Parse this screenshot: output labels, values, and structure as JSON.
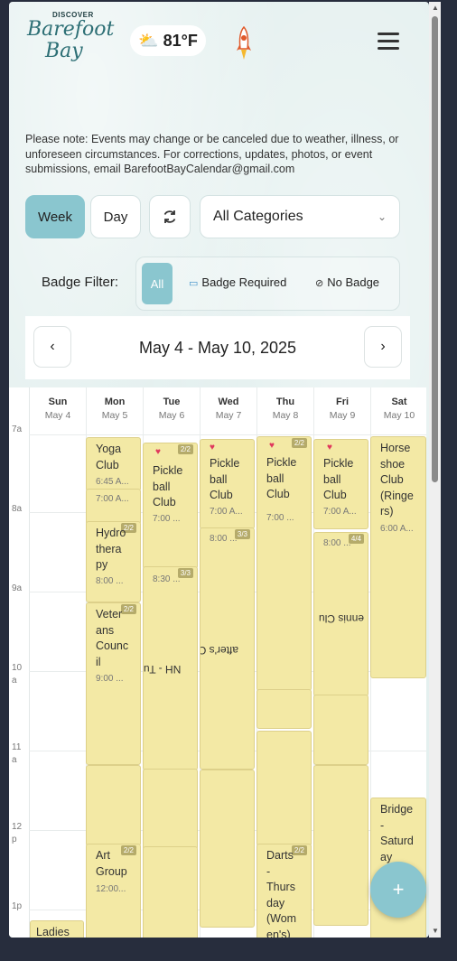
{
  "header": {
    "logo": {
      "small": "DISCOVER",
      "line1": "Barefoot",
      "line2": "Bay"
    },
    "weather": {
      "temp": "81°F",
      "icon": "partly-cloudy-icon"
    },
    "rocket_icon": "rocket-icon",
    "menu_icon": "hamburger-menu-icon"
  },
  "notice": "Please note: Events may change or be canceled due to weather, illness, or unforeseen circumstances. For corrections, updates, photos, or event submissions, email BarefootBayCalendar@gmail.com",
  "controls": {
    "week": "Week",
    "day": "Day",
    "refresh_icon": "refresh-icon",
    "category": "All Categories"
  },
  "badge_filter": {
    "label": "Badge Filter:",
    "all": "All",
    "required": "Badge Required",
    "none": "No Badge"
  },
  "week_nav": {
    "prev": "‹",
    "next": "›",
    "title": "May 4 - May 10, 2025"
  },
  "calendar": {
    "days": [
      {
        "name": "Sun",
        "date": "May 4"
      },
      {
        "name": "Mon",
        "date": "May 5"
      },
      {
        "name": "Tue",
        "date": "May 6"
      },
      {
        "name": "Wed",
        "date": "May 7"
      },
      {
        "name": "Thu",
        "date": "May 8"
      },
      {
        "name": "Fri",
        "date": "May 9"
      },
      {
        "name": "Sat",
        "date": "May 10"
      }
    ],
    "hours": [
      "7a",
      "8a",
      "9a",
      "10\na",
      "11\na",
      "12\np",
      "1p"
    ],
    "events": {
      "mon_yoga": {
        "title": "Yoga\nClub",
        "time": "6:45 A..."
      },
      "mon_club": {
        "title": "Club",
        "time": "7:00 A..."
      },
      "mon_hydro": {
        "title": "Hydro\nthera\npy",
        "time": "8:00 ...",
        "badge": "2/2"
      },
      "mon_vet": {
        "title": "Veter\nans\nCounc\nil",
        "time": "9:00 ...",
        "badge": "2/2"
      },
      "mon_art": {
        "title": "Art\nGroup",
        "time": "12:00...",
        "badge": "2/2"
      },
      "tue_pickle": {
        "title": "Pickle\nball\nClub",
        "time": "7:00 ...",
        "badge": "2/2"
      },
      "tue_830": {
        "time": "8:30 ...",
        "badge": "3/3"
      },
      "tue_rot": {
        "title": "NH - Tu"
      },
      "wed_pickle": {
        "title": "Pickle\nball\nClub",
        "time": "7:00 A..."
      },
      "wed_800": {
        "time": "8:00 ...",
        "badge": "3/3"
      },
      "wed_rot": {
        "title": "after's Cl"
      },
      "thu_pickle": {
        "title": "Pickle\nball\nClub",
        "time": "7:00 ...",
        "badge": "2/2"
      },
      "thu_darts": {
        "title": "Darts\n-\nThurs\nday\n(Wom\nen's)",
        "badge": "2/2"
      },
      "fri_pickle": {
        "title": "Pickle\nball\nClub",
        "time": "7:00 A..."
      },
      "fri_800": {
        "time": "8:00 ...",
        "badge": "4/4"
      },
      "fri_rot": {
        "title": "ennis Clu"
      },
      "sat_horse": {
        "title": "Horse\nshoe\nClub\n(Ringe\nrs)",
        "time": "6:00 A..."
      },
      "sat_bridge": {
        "title": "Bridge\n-\nSaturd\nay"
      },
      "sun_ladies": {
        "title": "Ladies"
      }
    }
  },
  "fab": "+"
}
